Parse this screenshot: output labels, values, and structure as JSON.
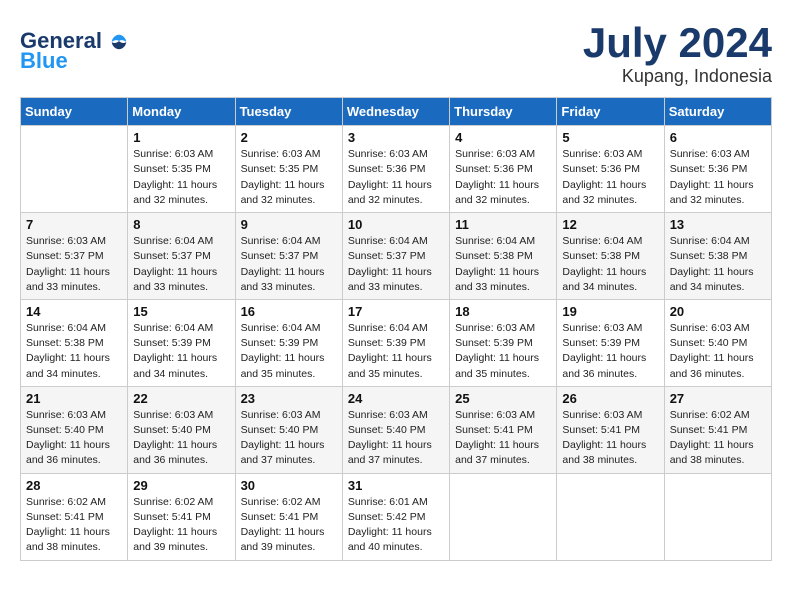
{
  "header": {
    "logo_line1": "General",
    "logo_line2": "Blue",
    "month_year": "July 2024",
    "location": "Kupang, Indonesia"
  },
  "weekdays": [
    "Sunday",
    "Monday",
    "Tuesday",
    "Wednesday",
    "Thursday",
    "Friday",
    "Saturday"
  ],
  "weeks": [
    [
      {
        "day": "",
        "info": ""
      },
      {
        "day": "1",
        "info": "Sunrise: 6:03 AM\nSunset: 5:35 PM\nDaylight: 11 hours\nand 32 minutes."
      },
      {
        "day": "2",
        "info": "Sunrise: 6:03 AM\nSunset: 5:35 PM\nDaylight: 11 hours\nand 32 minutes."
      },
      {
        "day": "3",
        "info": "Sunrise: 6:03 AM\nSunset: 5:36 PM\nDaylight: 11 hours\nand 32 minutes."
      },
      {
        "day": "4",
        "info": "Sunrise: 6:03 AM\nSunset: 5:36 PM\nDaylight: 11 hours\nand 32 minutes."
      },
      {
        "day": "5",
        "info": "Sunrise: 6:03 AM\nSunset: 5:36 PM\nDaylight: 11 hours\nand 32 minutes."
      },
      {
        "day": "6",
        "info": "Sunrise: 6:03 AM\nSunset: 5:36 PM\nDaylight: 11 hours\nand 32 minutes."
      }
    ],
    [
      {
        "day": "7",
        "info": "Sunrise: 6:03 AM\nSunset: 5:37 PM\nDaylight: 11 hours\nand 33 minutes."
      },
      {
        "day": "8",
        "info": "Sunrise: 6:04 AM\nSunset: 5:37 PM\nDaylight: 11 hours\nand 33 minutes."
      },
      {
        "day": "9",
        "info": "Sunrise: 6:04 AM\nSunset: 5:37 PM\nDaylight: 11 hours\nand 33 minutes."
      },
      {
        "day": "10",
        "info": "Sunrise: 6:04 AM\nSunset: 5:37 PM\nDaylight: 11 hours\nand 33 minutes."
      },
      {
        "day": "11",
        "info": "Sunrise: 6:04 AM\nSunset: 5:38 PM\nDaylight: 11 hours\nand 33 minutes."
      },
      {
        "day": "12",
        "info": "Sunrise: 6:04 AM\nSunset: 5:38 PM\nDaylight: 11 hours\nand 34 minutes."
      },
      {
        "day": "13",
        "info": "Sunrise: 6:04 AM\nSunset: 5:38 PM\nDaylight: 11 hours\nand 34 minutes."
      }
    ],
    [
      {
        "day": "14",
        "info": "Sunrise: 6:04 AM\nSunset: 5:38 PM\nDaylight: 11 hours\nand 34 minutes."
      },
      {
        "day": "15",
        "info": "Sunrise: 6:04 AM\nSunset: 5:39 PM\nDaylight: 11 hours\nand 34 minutes."
      },
      {
        "day": "16",
        "info": "Sunrise: 6:04 AM\nSunset: 5:39 PM\nDaylight: 11 hours\nand 35 minutes."
      },
      {
        "day": "17",
        "info": "Sunrise: 6:04 AM\nSunset: 5:39 PM\nDaylight: 11 hours\nand 35 minutes."
      },
      {
        "day": "18",
        "info": "Sunrise: 6:03 AM\nSunset: 5:39 PM\nDaylight: 11 hours\nand 35 minutes."
      },
      {
        "day": "19",
        "info": "Sunrise: 6:03 AM\nSunset: 5:39 PM\nDaylight: 11 hours\nand 36 minutes."
      },
      {
        "day": "20",
        "info": "Sunrise: 6:03 AM\nSunset: 5:40 PM\nDaylight: 11 hours\nand 36 minutes."
      }
    ],
    [
      {
        "day": "21",
        "info": "Sunrise: 6:03 AM\nSunset: 5:40 PM\nDaylight: 11 hours\nand 36 minutes."
      },
      {
        "day": "22",
        "info": "Sunrise: 6:03 AM\nSunset: 5:40 PM\nDaylight: 11 hours\nand 36 minutes."
      },
      {
        "day": "23",
        "info": "Sunrise: 6:03 AM\nSunset: 5:40 PM\nDaylight: 11 hours\nand 37 minutes."
      },
      {
        "day": "24",
        "info": "Sunrise: 6:03 AM\nSunset: 5:40 PM\nDaylight: 11 hours\nand 37 minutes."
      },
      {
        "day": "25",
        "info": "Sunrise: 6:03 AM\nSunset: 5:41 PM\nDaylight: 11 hours\nand 37 minutes."
      },
      {
        "day": "26",
        "info": "Sunrise: 6:03 AM\nSunset: 5:41 PM\nDaylight: 11 hours\nand 38 minutes."
      },
      {
        "day": "27",
        "info": "Sunrise: 6:02 AM\nSunset: 5:41 PM\nDaylight: 11 hours\nand 38 minutes."
      }
    ],
    [
      {
        "day": "28",
        "info": "Sunrise: 6:02 AM\nSunset: 5:41 PM\nDaylight: 11 hours\nand 38 minutes."
      },
      {
        "day": "29",
        "info": "Sunrise: 6:02 AM\nSunset: 5:41 PM\nDaylight: 11 hours\nand 39 minutes."
      },
      {
        "day": "30",
        "info": "Sunrise: 6:02 AM\nSunset: 5:41 PM\nDaylight: 11 hours\nand 39 minutes."
      },
      {
        "day": "31",
        "info": "Sunrise: 6:01 AM\nSunset: 5:42 PM\nDaylight: 11 hours\nand 40 minutes."
      },
      {
        "day": "",
        "info": ""
      },
      {
        "day": "",
        "info": ""
      },
      {
        "day": "",
        "info": ""
      }
    ]
  ]
}
